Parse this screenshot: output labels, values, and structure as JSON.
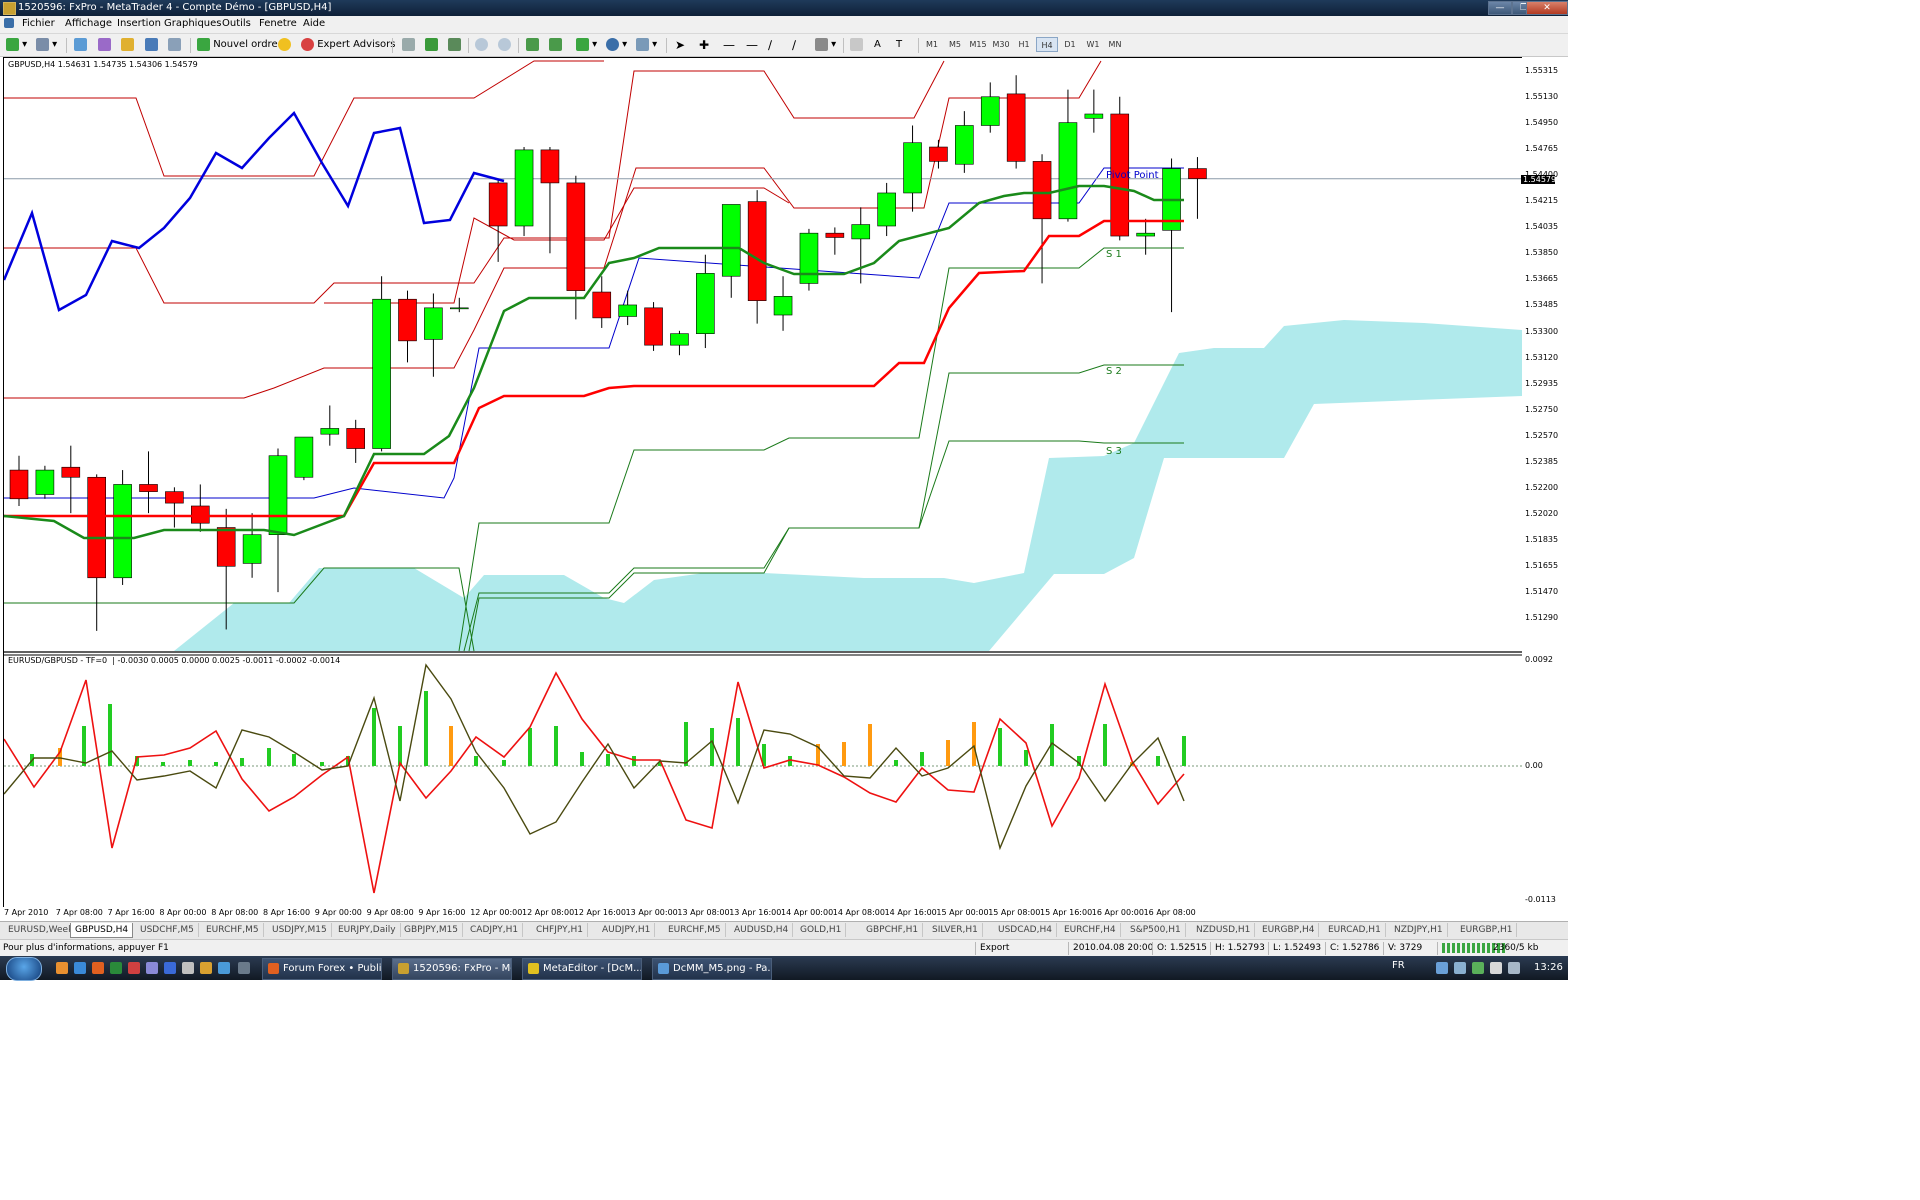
{
  "window": {
    "title": "1520596: FxPro - MetaTrader 4 - Compte Démo - [GBPUSD,H4]",
    "controls": [
      "minimize",
      "restore",
      "close"
    ]
  },
  "menu": [
    "Fichier",
    "Affichage",
    "Insertion",
    "Graphiques",
    "Outils",
    "Fenetre",
    "Aide"
  ],
  "toolbar": {
    "new_order": "Nouvel ordre",
    "expert_advisors": "Expert Advisors",
    "timeframes": [
      "M1",
      "M5",
      "M15",
      "M30",
      "H1",
      "H4",
      "D1",
      "W1",
      "MN"
    ],
    "active_timeframe": "H4"
  },
  "chart": {
    "symbol_header": "GBPUSD,H4  1.54631 1.54735 1.54306 1.54579",
    "indicator_header": "EURUSD/GBPUSD - TF=0",
    "indicator_values": "-0.0030 0.0005 0.0000 0.0025 -0.0011 -0.0002 -0.0014",
    "current_price": "1.54579",
    "price_labels": [
      "1.55315",
      "1.55130",
      "1.54950",
      "1.54765",
      "1.54400",
      "1.54215",
      "1.54035",
      "1.53850",
      "1.53665",
      "1.53485",
      "1.53300",
      "1.53120",
      "1.52935",
      "1.52750",
      "1.52570",
      "1.52385",
      "1.52200",
      "1.52020",
      "1.51835",
      "1.51655",
      "1.51470",
      "1.51290"
    ],
    "indicator_scale": [
      "0.0092",
      "0.00",
      "-0.0113"
    ],
    "pivot_labels": {
      "pp": "Pivot Point",
      "s1": "S 1",
      "s2": "S 2",
      "s3": "S 3"
    },
    "time_labels": [
      "7 Apr 2010",
      "7 Apr 08:00",
      "7 Apr 16:00",
      "8 Apr 00:00",
      "8 Apr 08:00",
      "8 Apr 16:00",
      "9 Apr 00:00",
      "9 Apr 08:00",
      "9 Apr 16:00",
      "12 Apr 00:00",
      "12 Apr 08:00",
      "12 Apr 16:00",
      "13 Apr 00:00",
      "13 Apr 08:00",
      "13 Apr 16:00",
      "14 Apr 00:00",
      "14 Apr 08:00",
      "14 Apr 16:00",
      "15 Apr 00:00",
      "15 Apr 08:00",
      "15 Apr 16:00",
      "16 Apr 00:00",
      "16 Apr 08:00"
    ],
    "colors": {
      "bull": "#00ff00",
      "bear": "#ff0000",
      "cloud": "#b0eaec",
      "tenkan": "#ff0000",
      "kijun": "#1a8a1a",
      "chikou": "#0000ff"
    }
  },
  "chart_data": {
    "type": "candlestick",
    "ylim": [
      1.5129,
      1.5542
    ],
    "candles": [
      {
        "o": 1.5255,
        "h": 1.5265,
        "l": 1.523,
        "c": 1.5235
      },
      {
        "o": 1.5238,
        "h": 1.5258,
        "l": 1.5235,
        "c": 1.5255
      },
      {
        "o": 1.5257,
        "h": 1.5272,
        "l": 1.5225,
        "c": 1.525
      },
      {
        "o": 1.525,
        "h": 1.5252,
        "l": 1.5143,
        "c": 1.518
      },
      {
        "o": 1.518,
        "h": 1.5255,
        "l": 1.5175,
        "c": 1.5245
      },
      {
        "o": 1.5245,
        "h": 1.5268,
        "l": 1.5225,
        "c": 1.524
      },
      {
        "o": 1.524,
        "h": 1.5243,
        "l": 1.5215,
        "c": 1.5232
      },
      {
        "o": 1.523,
        "h": 1.5245,
        "l": 1.5212,
        "c": 1.5218
      },
      {
        "o": 1.5215,
        "h": 1.5228,
        "l": 1.5144,
        "c": 1.5188
      },
      {
        "o": 1.519,
        "h": 1.5225,
        "l": 1.518,
        "c": 1.521
      },
      {
        "o": 1.521,
        "h": 1.527,
        "l": 1.517,
        "c": 1.5265
      },
      {
        "o": 1.525,
        "h": 1.5278,
        "l": 1.5248,
        "c": 1.5278
      },
      {
        "o": 1.528,
        "h": 1.53,
        "l": 1.5272,
        "c": 1.5284
      },
      {
        "o": 1.5284,
        "h": 1.529,
        "l": 1.526,
        "c": 1.527
      },
      {
        "o": 1.527,
        "h": 1.539,
        "l": 1.5268,
        "c": 1.5374
      },
      {
        "o": 1.5374,
        "h": 1.538,
        "l": 1.533,
        "c": 1.5345
      },
      {
        "o": 1.5346,
        "h": 1.5378,
        "l": 1.532,
        "c": 1.5368
      },
      {
        "o": 1.5368,
        "h": 1.5375,
        "l": 1.5365,
        "c": 1.5368
      },
      {
        "o": 1.5455,
        "h": 1.5458,
        "l": 1.54,
        "c": 1.5425
      },
      {
        "o": 1.5425,
        "h": 1.548,
        "l": 1.5418,
        "c": 1.5478
      },
      {
        "o": 1.5478,
        "h": 1.548,
        "l": 1.5406,
        "c": 1.5455
      },
      {
        "o": 1.5455,
        "h": 1.546,
        "l": 1.536,
        "c": 1.538
      },
      {
        "o": 1.5379,
        "h": 1.539,
        "l": 1.5354,
        "c": 1.5361
      },
      {
        "o": 1.5362,
        "h": 1.538,
        "l": 1.5356,
        "c": 1.537
      },
      {
        "o": 1.5368,
        "h": 1.5372,
        "l": 1.5338,
        "c": 1.5342
      },
      {
        "o": 1.5342,
        "h": 1.5352,
        "l": 1.5335,
        "c": 1.535
      },
      {
        "o": 1.535,
        "h": 1.5405,
        "l": 1.534,
        "c": 1.5392
      },
      {
        "o": 1.539,
        "h": 1.544,
        "l": 1.5375,
        "c": 1.544
      },
      {
        "o": 1.5442,
        "h": 1.545,
        "l": 1.5357,
        "c": 1.5373
      },
      {
        "o": 1.5363,
        "h": 1.539,
        "l": 1.5352,
        "c": 1.5376
      },
      {
        "o": 1.5385,
        "h": 1.5423,
        "l": 1.538,
        "c": 1.542
      },
      {
        "o": 1.542,
        "h": 1.5424,
        "l": 1.5405,
        "c": 1.5417
      },
      {
        "o": 1.5416,
        "h": 1.5438,
        "l": 1.5385,
        "c": 1.5426
      },
      {
        "o": 1.5425,
        "h": 1.5455,
        "l": 1.5418,
        "c": 1.5448
      },
      {
        "o": 1.5448,
        "h": 1.5495,
        "l": 1.5435,
        "c": 1.5483
      },
      {
        "o": 1.548,
        "h": 1.5485,
        "l": 1.5465,
        "c": 1.547
      },
      {
        "o": 1.5468,
        "h": 1.5505,
        "l": 1.5462,
        "c": 1.5495
      },
      {
        "o": 1.5495,
        "h": 1.5525,
        "l": 1.549,
        "c": 1.5515
      },
      {
        "o": 1.5517,
        "h": 1.553,
        "l": 1.5465,
        "c": 1.547
      },
      {
        "o": 1.547,
        "h": 1.5475,
        "l": 1.5385,
        "c": 1.543
      },
      {
        "o": 1.543,
        "h": 1.552,
        "l": 1.5428,
        "c": 1.5497
      },
      {
        "o": 1.55,
        "h": 1.552,
        "l": 1.549,
        "c": 1.5503
      },
      {
        "o": 1.5503,
        "h": 1.5515,
        "l": 1.5415,
        "c": 1.5418
      },
      {
        "o": 1.5418,
        "h": 1.543,
        "l": 1.5405,
        "c": 1.542
      },
      {
        "o": 1.5422,
        "h": 1.5472,
        "l": 1.5365,
        "c": 1.5465
      },
      {
        "o": 1.5465,
        "h": 1.5473,
        "l": 1.543,
        "c": 1.5458
      }
    ]
  },
  "tabs": [
    "EURUSD,Weekly",
    "GBPUSD,H4",
    "USDCHF,M5",
    "EURCHF,M5",
    "USDJPY,M15",
    "EURJPY,Daily",
    "GBPJPY,M15",
    "CADJPY,H1",
    "CHFJPY,H1",
    "AUDJPY,H1",
    "EURCHF,M5",
    "AUDUSD,H4",
    "GOLD,H1",
    "GBPCHF,H1",
    "SILVER,H1",
    "USDCAD,H4",
    "EURCHF,H4",
    "S&P500,H1",
    "NZDUSD,H1",
    "EURGBP,H4",
    "EURCAD,H1",
    "NZDJPY,H1",
    "EURGBP,H1"
  ],
  "active_tab": "GBPUSD,H4",
  "status": {
    "help": "Pour plus d'informations, appuyer F1",
    "profile": "Export",
    "datetime": "2010.04.08 20:00",
    "open": "O: 1.52515",
    "high": "H: 1.52793",
    "low": "L: 1.52493",
    "close": "C: 1.52786",
    "volume": "V: 3729",
    "traffic": "2360/5 kb"
  },
  "taskbar": {
    "items": [
      "Forum Forex • Publi...",
      "1520596: FxPro - Me...",
      "MetaEditor - [DcM...",
      "DcMM_M5.png - Pa..."
    ],
    "language": "FR",
    "clock": "13:26"
  }
}
